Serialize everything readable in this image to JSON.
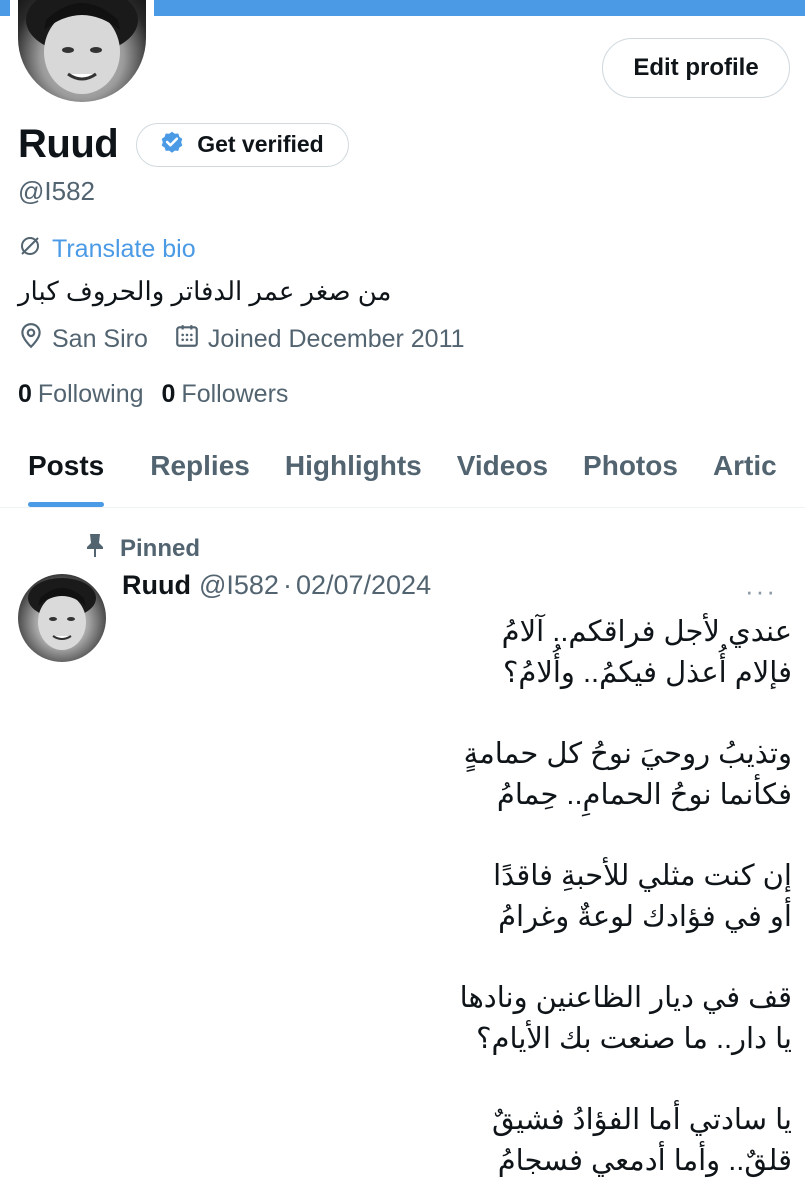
{
  "profile": {
    "name": "Ruud",
    "handle": "@I582",
    "get_verified_label": "Get verified",
    "edit_profile_label": "Edit profile",
    "translate_bio_label": "Translate bio",
    "bio": "من صغر عمر الدفاتر والحروف كبار",
    "location": "San Siro",
    "joined": "Joined December 2011",
    "following_count": "0",
    "following_label": "Following",
    "followers_count": "0",
    "followers_label": "Followers"
  },
  "tabs": [
    {
      "label": "Posts",
      "active": true
    },
    {
      "label": "Replies"
    },
    {
      "label": "Highlights"
    },
    {
      "label": "Videos"
    },
    {
      "label": "Photos"
    },
    {
      "label": "Artic"
    }
  ],
  "post": {
    "pinned_label": "Pinned",
    "author_name": "Ruud",
    "author_handle": "@I582",
    "separator": "·",
    "date": "02/07/2024",
    "more": "···",
    "lines": [
      "عندي لأجل فراقكم.. آلامُ",
      "فإلام أُعذل فيكمُ.. وأُلامُ؟",
      "",
      "وتذيبُ روحيَ نوحُ كل حمامةٍ",
      "فكأنما نوحُ الحمامِ.. حِمامُ",
      "",
      "إن كنت مثلي للأحبةِ فاقدًا",
      "أو في فؤادك لوعةٌ وغرامُ",
      "",
      "قف في ديار الظاعنين ونادها",
      "يا دار.. ما صنعت بك الأيام؟",
      "",
      "يا سادتي أما الفؤادُ فشيقٌ",
      "قلقٌ.. وأما أدمعي فسجامُ"
    ]
  },
  "colors": {
    "accent": "#4a9ae6",
    "text": "#0f1419",
    "secondary": "#536471"
  }
}
